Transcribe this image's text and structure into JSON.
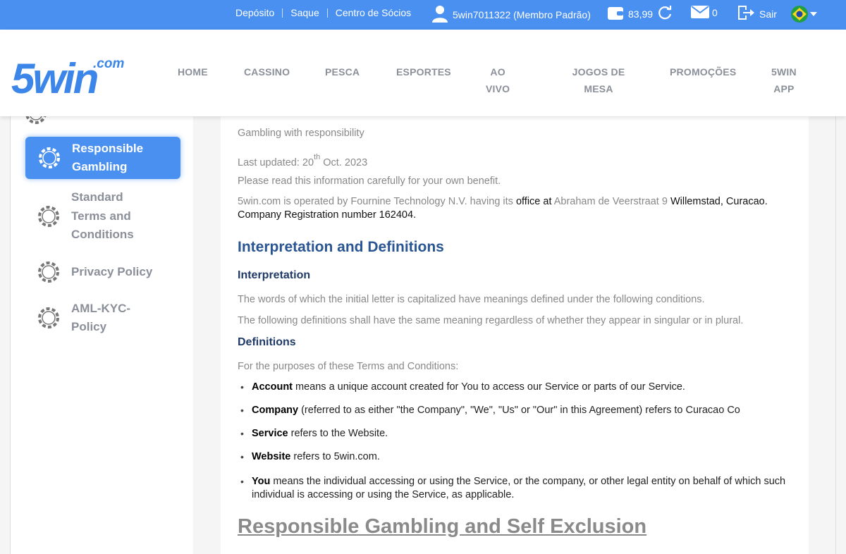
{
  "colors": {
    "topbar": "#4a90f0",
    "nav_text": "#8a8f99",
    "heading": "#2a5593",
    "sidebar_active": "#4a90f0"
  },
  "topbar": {
    "links": [
      "Depósito",
      "Saque",
      "Centro de Sócios"
    ],
    "user": "5win7011322 (Membro Padrão)",
    "balance": "83,99",
    "messages": "0",
    "logout": "Sair",
    "language_icon": "brazil-flag-icon"
  },
  "logo": {
    "main": "5win",
    "suffix": ".com"
  },
  "nav": [
    "HOME",
    "CASSINO",
    "PESCA",
    "ESPORTES",
    "AO VIVO",
    "JOGOS DE MESA",
    "PROMOÇÕES",
    "5WIN APP"
  ],
  "sidebar": {
    "items": [
      {
        "label": "Responsible Gambling",
        "icon": "chip-icon",
        "active": true
      },
      {
        "label": "Standard Terms and Conditions",
        "icon": "chip-icon",
        "active": false
      },
      {
        "label": "Privacy Policy",
        "icon": "chip-icon",
        "active": false
      },
      {
        "label": "AML-KYC-Policy",
        "icon": "chip-icon",
        "active": false
      }
    ]
  },
  "content": {
    "intro": "Gambling with responsibility",
    "updated_prefix": "Last updated: 20",
    "updated_sup": "th",
    "updated_suffix": " Oct. 2023",
    "read": "Please read this information carefully for your own benefit.",
    "operator_a": "5win.com is operated by Fournine Technology N.V. having its ",
    "operator_b": "office at",
    "operator_c": " Abraham de Veerstraat 9 ",
    "operator_d": "Willemstad, Curacao.",
    "operator_e": "Company Registration number 162404.",
    "h2": "Interpretation and Definitions",
    "h3_interp": "Interpretation",
    "interp_1": "The words of which the initial letter is capitalized have meanings defined under the following conditions.",
    "interp_2": "The following definitions shall have the same meaning regardless of whether they appear in singular or in plural.",
    "h3_def": "Definitions",
    "def_intro": "For the purposes of these Terms and Conditions:",
    "defs": [
      {
        "term": "Account",
        "text": " means a unique account created for You to access our Service or parts of our Service."
      },
      {
        "term": "Company",
        "text": " (referred to as either \"the Company\", \"We\", \"Us\" or \"Our\" in this Agreement) refers to Curacao Co"
      },
      {
        "term": "Service",
        "text": " refers to the Website."
      },
      {
        "term": "Website",
        "text": " refers to 5win.com."
      },
      {
        "term": "You",
        "text": " means the individual accessing or using the Service, or the company, or other legal entity on behalf of which such individual is accessing or using the Service, as applicable."
      }
    ],
    "section_link": "Responsible Gambling and Self Exclusion"
  }
}
